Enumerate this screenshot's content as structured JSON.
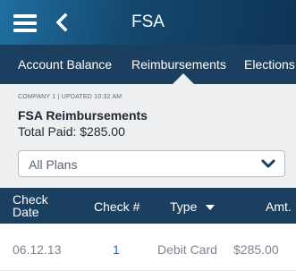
{
  "header": {
    "title": "FSA",
    "menu_icon": "hamburger-menu-icon",
    "back_icon": "chevron-left-icon"
  },
  "tabs": [
    {
      "label": "Account Balance",
      "active": false
    },
    {
      "label": "Reimbursements",
      "active": true
    },
    {
      "label": "Elections",
      "active": false
    }
  ],
  "summary": {
    "meta": "COMPANY 1 | UPDATED 10:32 AM",
    "heading": "FSA Reimbursements",
    "total_paid": "Total Paid: $285.00",
    "plan_filter": {
      "selected": "All Plans",
      "icon": "chevron-down-icon"
    }
  },
  "table": {
    "columns": {
      "date_line1": "Check",
      "date_line2": "Date",
      "check": "Check #",
      "type": "Type",
      "amount": "Amt."
    },
    "sort_icon": "caret-down-icon",
    "rows": [
      {
        "date": "06.12.13",
        "check": "1",
        "type": "Debit Card",
        "amount": "$285.00"
      }
    ]
  },
  "colors": {
    "header_gradient": [
      "#1f6fa0",
      "#0e3556"
    ],
    "nav_bar": "#1b3f5e",
    "summary_bg": "#eeeff1",
    "link": "#1f69c9",
    "chevron": "#1b3f5e"
  }
}
